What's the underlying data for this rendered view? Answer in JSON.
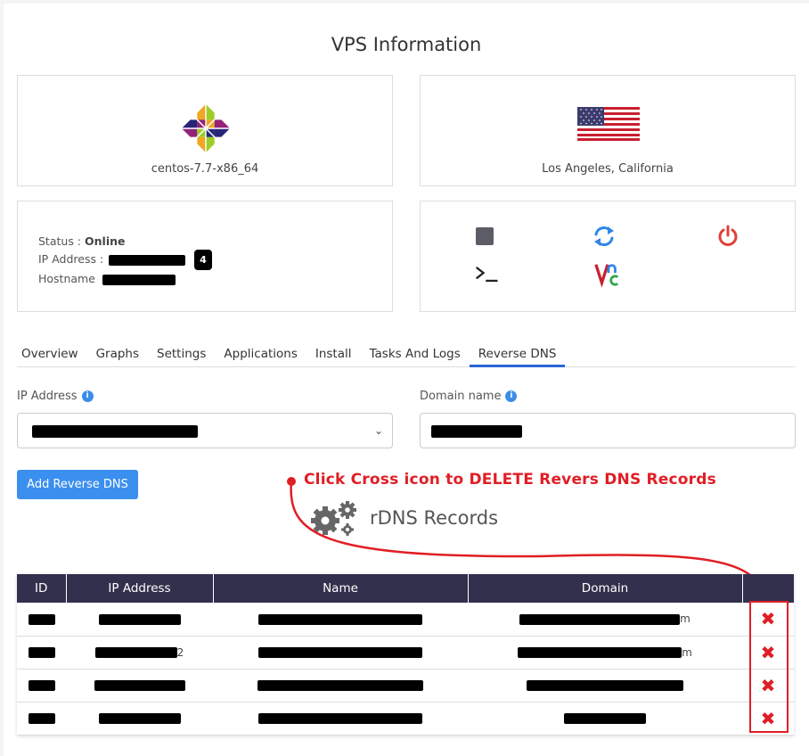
{
  "page_title": "VPS Information",
  "os": {
    "name": "centos-7.7-x86_64",
    "logo_icon": "centos-logo-icon"
  },
  "location": {
    "name": "Los Angeles, California",
    "flag_icon": "us-flag-icon"
  },
  "status": {
    "status_label": "Status :",
    "status_value": "Online",
    "ip_label": "IP Address :",
    "ip_badge": "4",
    "hostname_label": "Hostname"
  },
  "controls": [
    "stop-icon",
    "restart-icon",
    "power-icon",
    "console-icon",
    "vnc-icon"
  ],
  "tabs": [
    "Overview",
    "Graphs",
    "Settings",
    "Applications",
    "Install",
    "Tasks And Logs",
    "Reverse DNS"
  ],
  "active_tab": "Reverse DNS",
  "form": {
    "ip_label": "IP Address",
    "domain_label": "Domain name",
    "add_button": "Add Reverse DNS"
  },
  "annotation": "Click Cross icon to DELETE Revers DNS Records",
  "records": {
    "title": "rDNS Records",
    "columns": [
      "ID",
      "IP Address",
      "Name",
      "Domain",
      ""
    ],
    "rows": [
      {
        "ip_suffix": "",
        "domain_suffix": "m"
      },
      {
        "ip_suffix": "2",
        "domain_suffix": "m"
      },
      {
        "ip_suffix": "",
        "domain_suffix": ""
      },
      {
        "ip_suffix": "",
        "domain_suffix": ""
      }
    ]
  },
  "colors": {
    "accent": "#2a64d6",
    "button": "#3b8fef",
    "header_bg": "#33304d",
    "annotation": "#e01e25"
  }
}
